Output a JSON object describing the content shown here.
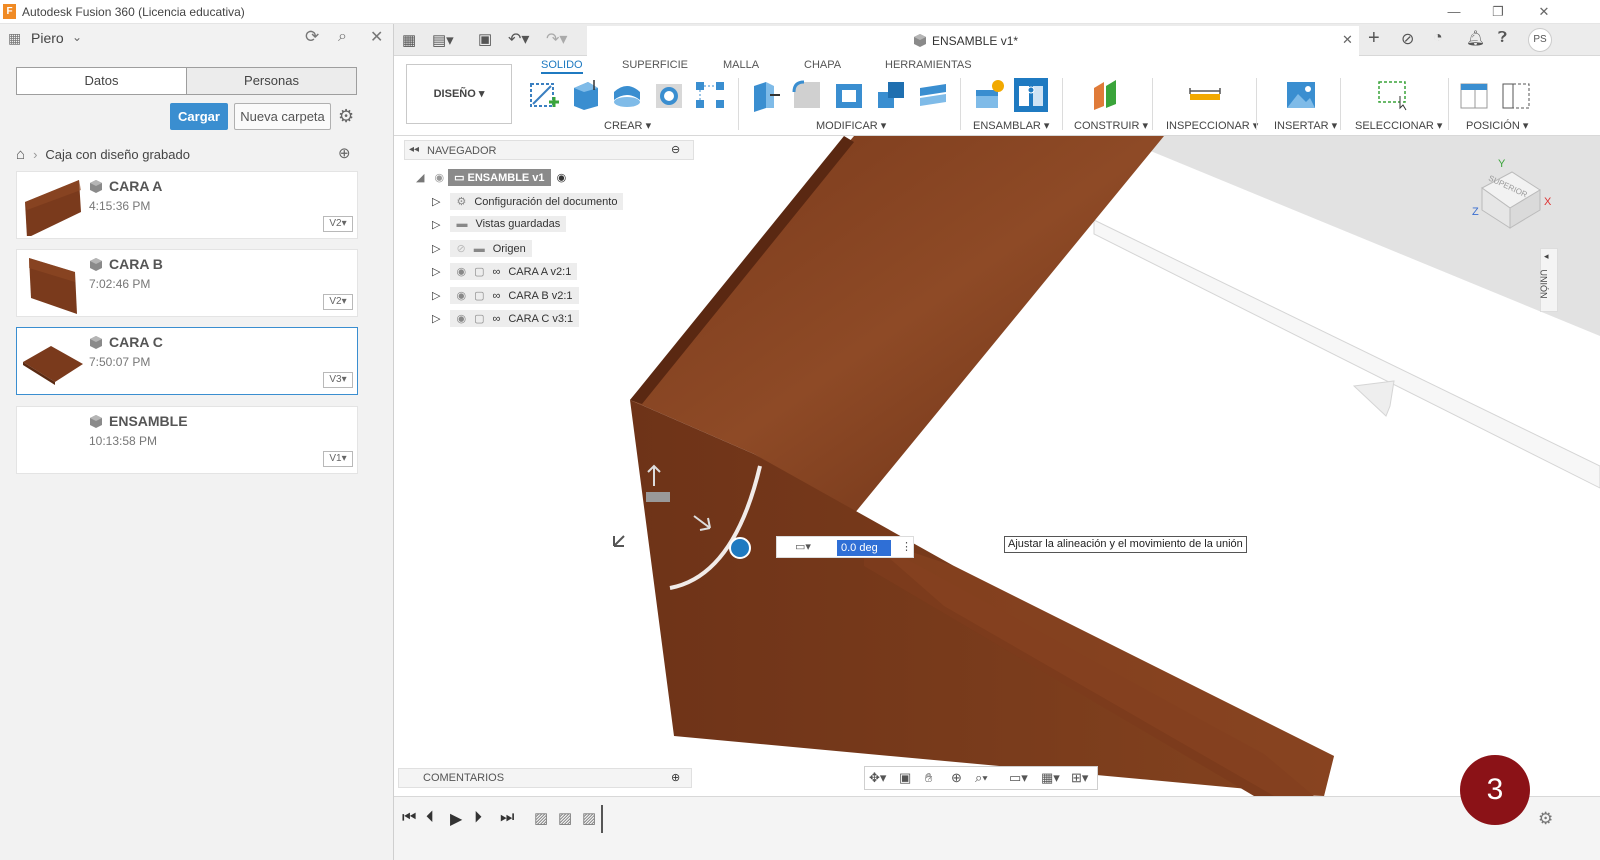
{
  "window": {
    "title": "Autodesk Fusion 360 (Licencia educativa)",
    "logo_letter": "F"
  },
  "data_panel": {
    "user": "Piero",
    "tabs": [
      "Datos",
      "Personas"
    ],
    "upload_label": "Cargar",
    "new_folder_label": "Nueva carpeta",
    "breadcrumb": "Caja con diseño grabado",
    "files": [
      {
        "name": "CARA A",
        "time": "4:15:36 PM",
        "version": "V2"
      },
      {
        "name": "CARA B",
        "time": "7:02:46 PM",
        "version": "V2"
      },
      {
        "name": "CARA C",
        "time": "7:50:07 PM",
        "version": "V3"
      },
      {
        "name": "ENSAMBLE",
        "time": "10:13:58 PM",
        "version": "V1"
      }
    ]
  },
  "document": {
    "tab_title": "ENSAMBLE v1*",
    "user_initials": "PS"
  },
  "ribbon": {
    "workspace": "DISEÑO",
    "tabs": [
      "SOLIDO",
      "SUPERFICIE",
      "MALLA",
      "CHAPA",
      "HERRAMIENTAS"
    ],
    "active_tab": "SOLIDO",
    "groups": [
      "CREAR",
      "MODIFICAR",
      "ENSAMBLAR",
      "CONSTRUIR",
      "INSPECCIONAR",
      "INSERTAR",
      "SELECCIONAR",
      "POSICIÓN"
    ]
  },
  "navigator": {
    "title": "NAVEGADOR",
    "root": "ENSAMBLE v1",
    "items": [
      "Configuración del documento",
      "Vistas guardadas",
      "Origen",
      "CARA A v2:1",
      "CARA B v2:1",
      "CARA C v3:1"
    ]
  },
  "viewport": {
    "angle_value": "0.0 deg",
    "tooltip": "Ajustar la alineación y el movimiento de la unión",
    "viewcube_label": "SUPERIOR",
    "side_panel_label": "UNIÓN",
    "axis_x": "X",
    "axis_y": "Y",
    "axis_z": "Z"
  },
  "comments": {
    "title": "COMENTARIOS"
  },
  "badge": "3",
  "colors": {
    "accent": "#1f7ac1",
    "primary_button": "#3a8ed0",
    "wood": "#7a3a1c",
    "badge": "#8b1217"
  }
}
